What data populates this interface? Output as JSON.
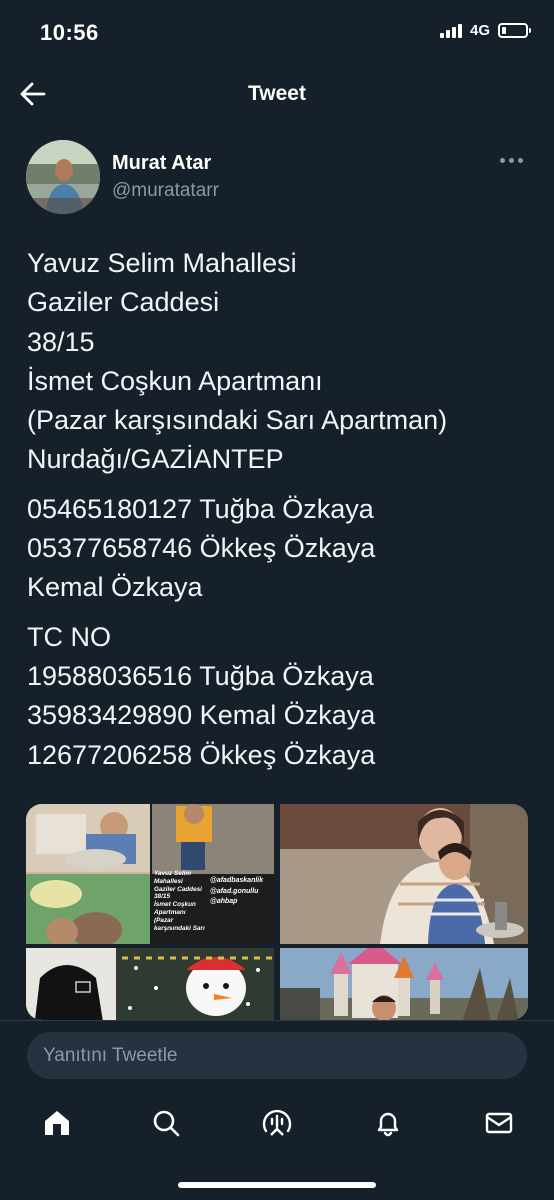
{
  "status_bar": {
    "time": "10:56",
    "network": "4G"
  },
  "header": {
    "title": "Tweet"
  },
  "tweet": {
    "author_name": "Murat Atar",
    "author_handle": "@muratatarr",
    "paragraphs": [
      [
        "Yavuz Selim Mahallesi",
        "Gaziler Caddesi",
        "38/15",
        "İsmet Coşkun Apartmanı",
        "(Pazar karşısındaki Sarı Apartman)",
        "Nurdağı/GAZİANTEP"
      ],
      [
        "05465180127 Tuğba Özkaya",
        "05377658746 Ökkeş Özkaya",
        "Kemal Özkaya"
      ],
      [
        "TC NO",
        "19588036516 Tuğba Özkaya",
        "35983429890 Kemal Özkaya",
        "12677206258 Ökkeş Özkaya"
      ]
    ],
    "media_overlay": {
      "address_lines": [
        "Yavuz Selim",
        "Mahallesi",
        "Gaziler Caddesi",
        "38/15",
        "İsmet Coşkun",
        "Apartmanı",
        "(Pazar",
        "karşısındaki Sarı"
      ],
      "tags": [
        "@afadbaskanlik",
        "@afad.gonullu",
        "@ahbap"
      ]
    }
  },
  "reply": {
    "placeholder": "Yanıtını Tweetle"
  },
  "nav": {
    "items": [
      {
        "name": "home",
        "icon": "home-icon"
      },
      {
        "name": "search",
        "icon": "search-icon"
      },
      {
        "name": "spaces",
        "icon": "spaces-icon"
      },
      {
        "name": "notifications",
        "icon": "bell-icon"
      },
      {
        "name": "messages",
        "icon": "mail-icon"
      }
    ]
  }
}
